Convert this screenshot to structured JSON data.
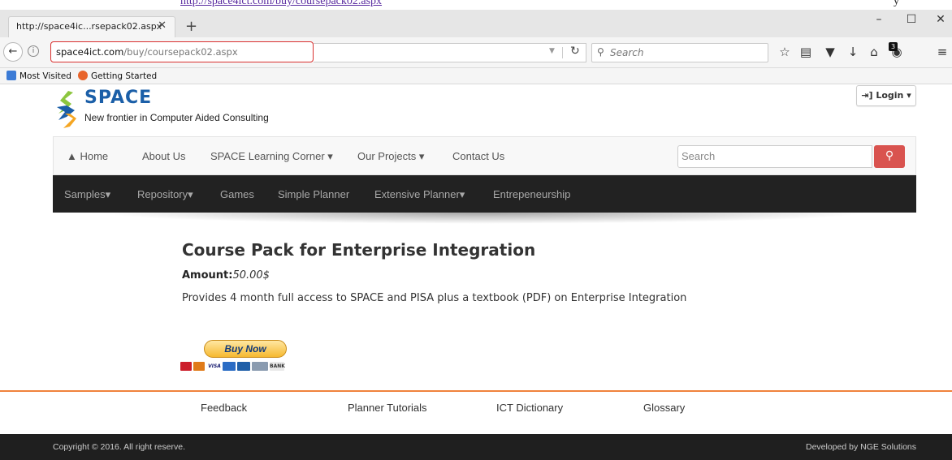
{
  "browser": {
    "top_link_text": "http://space4ict.com/buy/coursepack02.aspx",
    "top_right_text": "y",
    "tab_title": "http://space4ic...rsepack02.aspx",
    "tab_close": "✕",
    "new_tab": "+",
    "window_buttons": [
      "–",
      "☐",
      "✕"
    ],
    "url_host": "space4ict.com",
    "url_path": "/buy/coursepack02.aspx",
    "search_placeholder": "Search",
    "bookmarks": [
      {
        "label": "Most Visited",
        "color": "#3b7bd6"
      },
      {
        "label": "Getting Started",
        "color": "#e8642b"
      }
    ],
    "toolbar_icons": [
      "star-icon",
      "reading-list-icon",
      "pocket-icon",
      "download-icon",
      "home-icon",
      "extension-icon",
      "menu-icon"
    ],
    "extension_badge": "3"
  },
  "site": {
    "brand": "SPACE",
    "tagline": "New frontier in Computer Aided Consulting",
    "login_label": "⇥] Login ▾",
    "nav": [
      {
        "label": "Home"
      },
      {
        "label": "About Us"
      },
      {
        "label": "SPACE Learning Corner ▾"
      },
      {
        "label": "Our Projects ▾"
      },
      {
        "label": "Contact Us"
      }
    ],
    "search_placeholder": "Search",
    "sub_nav": [
      {
        "label": "Samples▾"
      },
      {
        "label": "Repository▾"
      },
      {
        "label": "Games"
      },
      {
        "label": "Simple Planner"
      },
      {
        "label": "Extensive Planner▾"
      },
      {
        "label": "Entrepeneurship"
      }
    ],
    "accent_color": "#d9534f"
  },
  "content": {
    "title": "Course Pack for Enterprise Integration",
    "amount_label": "Amount:",
    "amount_value": "50.00$",
    "description": "Provides 4 month full access to SPACE and PISA plus a textbook (PDF) on Enterprise Integration",
    "buy_button": "Buy Now",
    "payment_cards": [
      "",
      "",
      "VISA",
      "",
      "",
      "",
      "BANK"
    ]
  },
  "footer": {
    "links": [
      "Feedback",
      "Planner Tutorials",
      "ICT Dictionary",
      "Glossary"
    ],
    "copyright": "Copyright © 2016. All right reserve.",
    "developer": "Developed by NGE Solutions"
  }
}
